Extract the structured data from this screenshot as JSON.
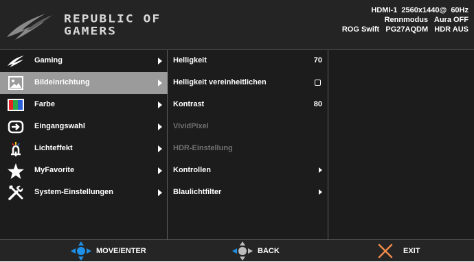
{
  "header": {
    "brand_line1": "REPUBLIC OF",
    "brand_line2": "GAMERS",
    "info_line1": "HDMI-1  2560x1440@  60Hz",
    "info_line2": "Rennmodus   Aura OFF",
    "info_line3": "ROG Swift   PG27AQDM   HDR AUS"
  },
  "main_menu": {
    "items": [
      {
        "label": "Gaming",
        "icon": "rog-eye-icon"
      },
      {
        "label": "Bildeinrichtung",
        "icon": "image-icon"
      },
      {
        "label": "Farbe",
        "icon": "color-bars-icon"
      },
      {
        "label": "Eingangswahl",
        "icon": "input-icon"
      },
      {
        "label": "Lichteffekt",
        "icon": "light-effect-icon"
      },
      {
        "label": "MyFavorite",
        "icon": "star-icon"
      },
      {
        "label": "System-Einstellungen",
        "icon": "tools-icon"
      }
    ],
    "selected": "Bildeinrichtung"
  },
  "submenu": {
    "items": [
      {
        "label": "Helligkeit",
        "value": "70"
      },
      {
        "label": "Helligkeit vereinheitlichen"
      },
      {
        "label": "Kontrast",
        "value": "80"
      },
      {
        "label": "VividPixel"
      },
      {
        "label": "HDR-Einstellung"
      },
      {
        "label": "Kontrollen"
      },
      {
        "label": "Blaulichtfilter"
      }
    ]
  },
  "footer": {
    "move_label": "MOVE/ENTER",
    "back_label": "BACK",
    "exit_label": "EXIT"
  },
  "colors": {
    "accent_blue": "#1e90e8",
    "exit_orange": "#f08a4b",
    "selected_bg": "#9b9b9b"
  }
}
